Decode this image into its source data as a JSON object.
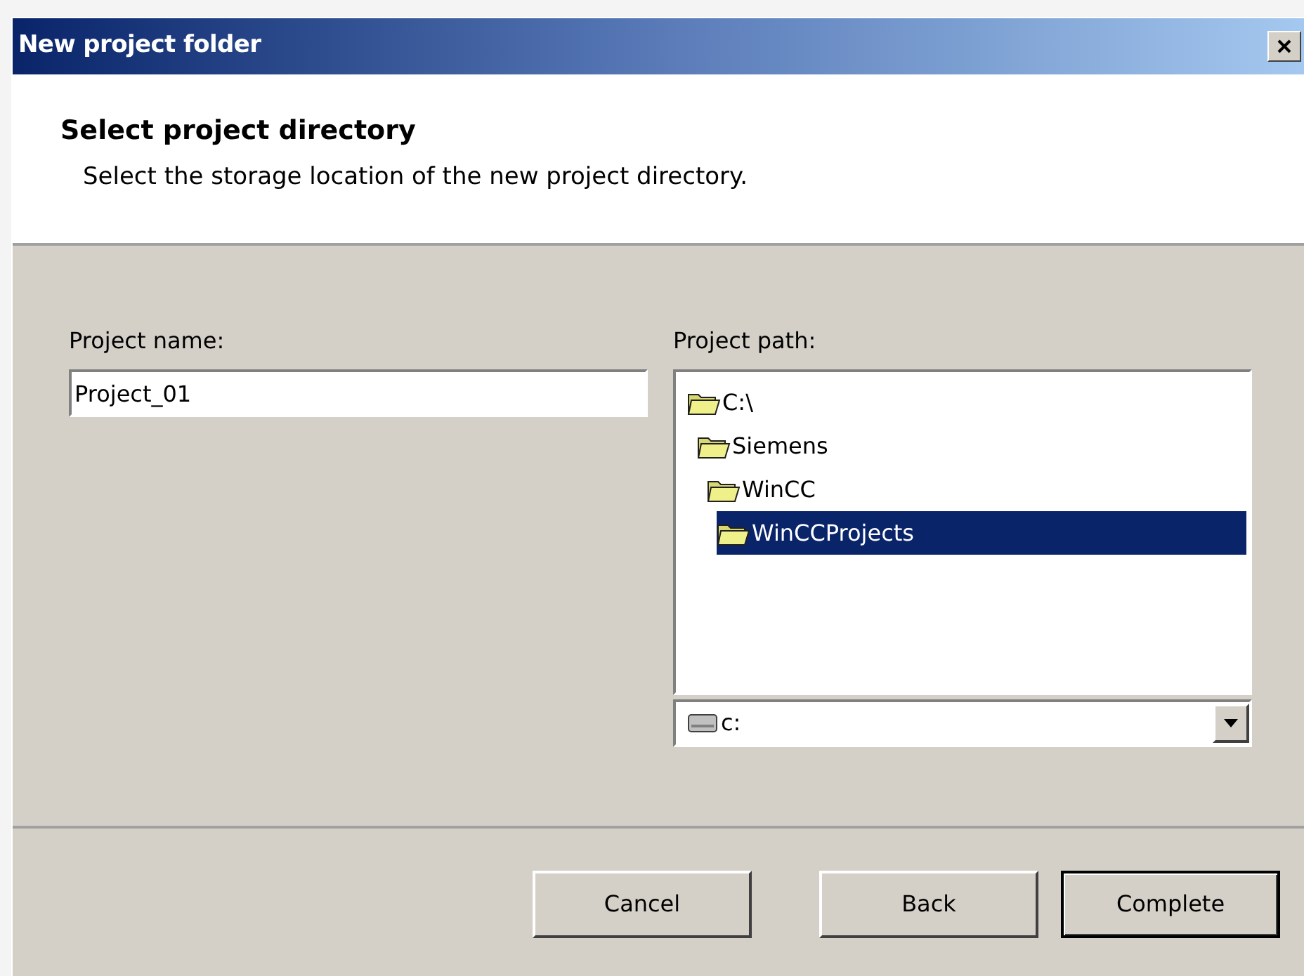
{
  "window": {
    "title": "New project folder"
  },
  "header": {
    "title": "Select project directory",
    "subtitle": "Select the storage location of the new project directory."
  },
  "project_name": {
    "label": "Project name:",
    "value": "Project_01"
  },
  "project_path": {
    "label": "Project path:",
    "tree": [
      {
        "label": "C:\\",
        "selected": false,
        "children": [
          {
            "label": "Siemens",
            "selected": false,
            "children": [
              {
                "label": "WinCC",
                "selected": false,
                "children": [
                  {
                    "label": "WinCCProjects",
                    "selected": true
                  }
                ]
              }
            ]
          }
        ]
      }
    ],
    "drive": {
      "value": "c:"
    }
  },
  "buttons": [
    {
      "label": "Cancel",
      "default": false
    },
    {
      "label": "Back",
      "default": false
    },
    {
      "label": "Complete",
      "default": true
    }
  ]
}
